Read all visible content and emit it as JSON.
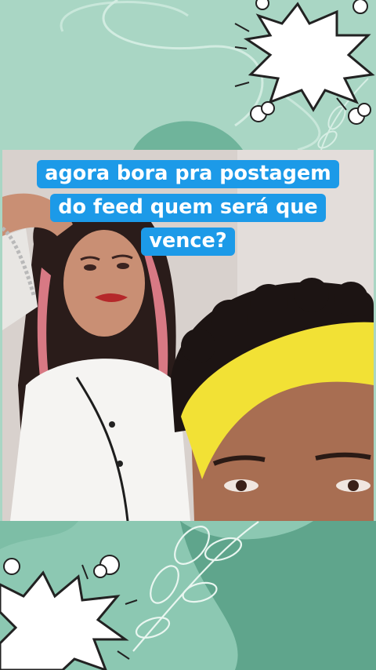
{
  "caption": {
    "lines": [
      "agora bora pra postagem",
      "do feed quem será que",
      "vence?"
    ]
  },
  "colors": {
    "background": "#a9d6c4",
    "background_dark": "#7fbfa8",
    "caption_bg": "#1c9ae8",
    "caption_text": "#ffffff",
    "headband": "#f2e135"
  },
  "icons": {
    "top_right": "comic-burst-icon",
    "bottom_left": "comic-burst-icon",
    "leaf": "leaf-branch-icon"
  }
}
